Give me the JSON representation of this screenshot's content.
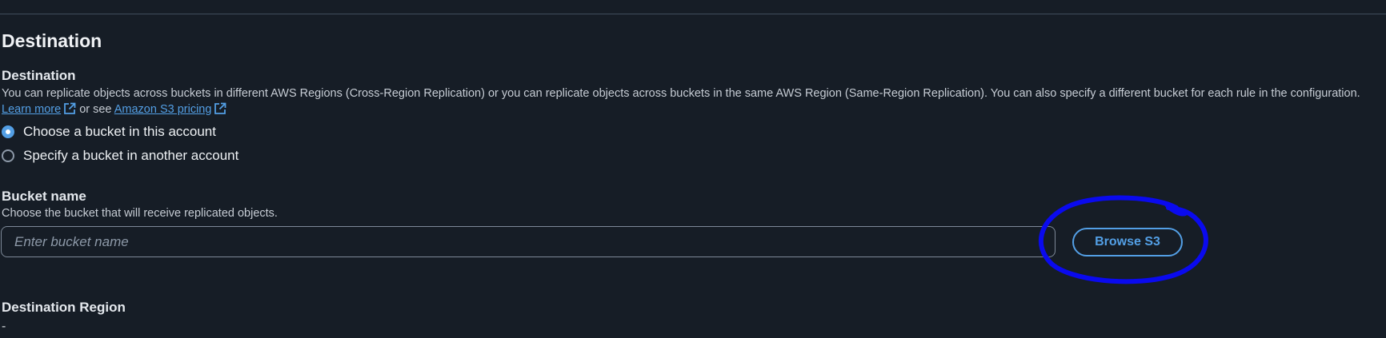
{
  "section": {
    "title": "Destination"
  },
  "destination": {
    "label": "Destination",
    "description_prefix": "You can replicate objects across buckets in different AWS Regions (Cross-Region Replication) or you can replicate objects across buckets in the same AWS Region (Same-Region Replication). You can also specify a different bucket for each rule in the configuration.",
    "learn_more_link": "Learn more",
    "or_see_text": "or see",
    "pricing_link": "Amazon S3 pricing",
    "options": [
      {
        "label": "Choose a bucket in this account",
        "selected": true
      },
      {
        "label": "Specify a bucket in another account",
        "selected": false
      }
    ]
  },
  "bucket_name": {
    "label": "Bucket name",
    "description": "Choose the bucket that will receive replicated objects.",
    "value": "",
    "placeholder": "Enter bucket name",
    "browse_button": "Browse S3"
  },
  "destination_region": {
    "label": "Destination Region",
    "value": "-"
  },
  "colors": {
    "background": "#161d26",
    "accent": "#539fe5",
    "annotation": "#0a0aee"
  }
}
